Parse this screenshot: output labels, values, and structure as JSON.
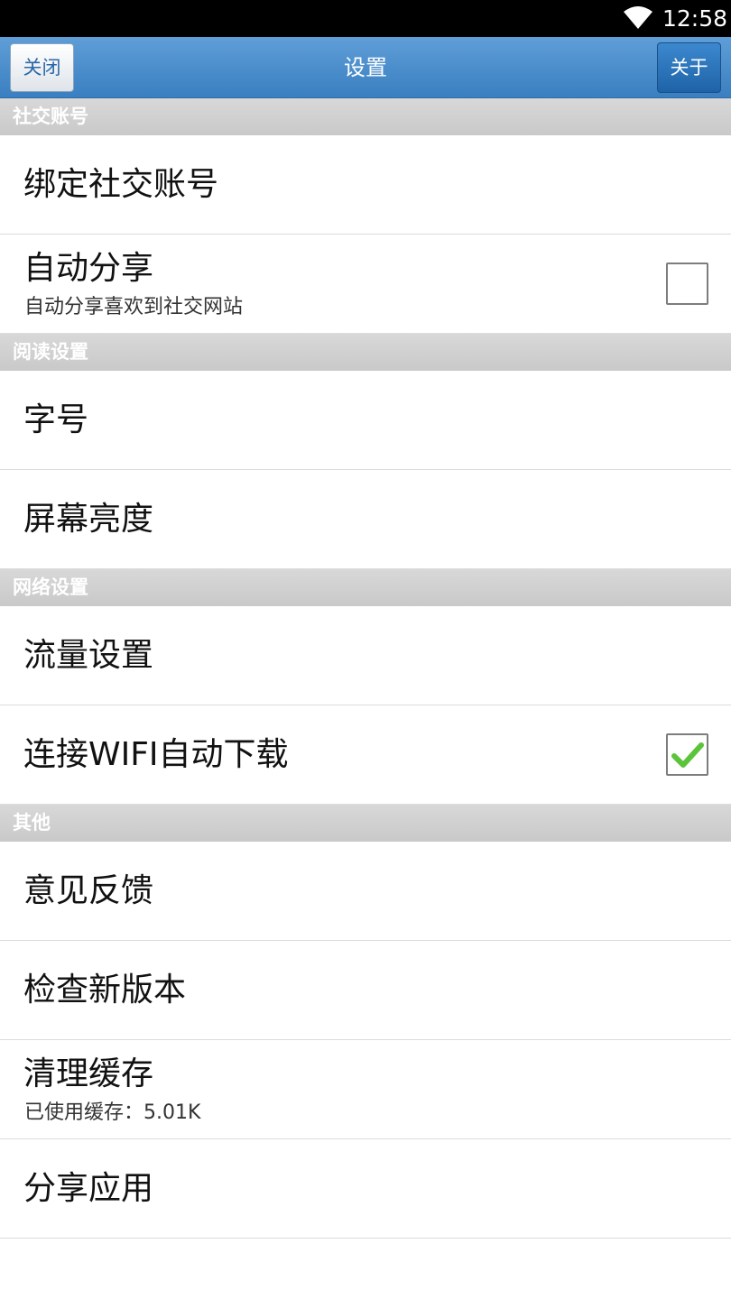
{
  "status_bar": {
    "time": "12:58"
  },
  "title_bar": {
    "close_label": "关闭",
    "title": "设置",
    "about_label": "关于"
  },
  "sections": {
    "social": {
      "header": "社交账号",
      "bind_account": "绑定社交账号",
      "auto_share": {
        "label": "自动分享",
        "sub": "自动分享喜欢到社交网站",
        "checked": false
      }
    },
    "reading": {
      "header": "阅读设置",
      "font_size": "字号",
      "brightness": "屏幕亮度"
    },
    "network": {
      "header": "网络设置",
      "traffic": "流量设置",
      "wifi_download": {
        "label": "连接WIFI自动下载",
        "checked": true
      }
    },
    "other": {
      "header": "其他",
      "feedback": "意见反馈",
      "check_version": "检查新版本",
      "clear_cache": {
        "label": "清理缓存",
        "sub": "已使用缓存：5.01K"
      },
      "share_app": "分享应用"
    }
  },
  "colors": {
    "title_bar": "#4a8fcf",
    "section_header": "#cfcfcf",
    "check_green": "#5cc43a"
  }
}
